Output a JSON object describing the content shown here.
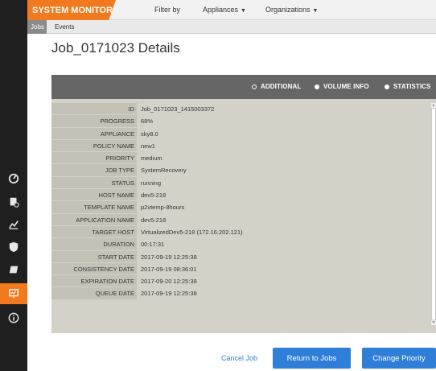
{
  "app": {
    "brand": "SYSTEM MONITOR",
    "colors": {
      "accent": "#f07a1d",
      "primary_button": "#2f7fd8",
      "rail": "#1f1f1f"
    }
  },
  "topbar": {
    "filter_label": "Filter by",
    "appliances_label": "Appliances",
    "organizations_label": "Organizations"
  },
  "subnav": {
    "tabs": [
      {
        "label": "Jobs",
        "active": true
      },
      {
        "label": "Events",
        "active": false
      }
    ]
  },
  "sidebar": {
    "icons": [
      "dashboard-icon",
      "storage-icon",
      "chart-icon",
      "shield-icon",
      "drive-icon",
      "monitor-icon",
      "info-icon"
    ],
    "active": "monitor-icon"
  },
  "page": {
    "title": "Job_0171023 Details"
  },
  "panel": {
    "tabs": [
      {
        "label": "ADDITIONAL",
        "selected": true
      },
      {
        "label": "VOLUME INFO",
        "selected": false
      },
      {
        "label": "STATISTICS",
        "selected": false
      }
    ],
    "rows": [
      {
        "label": "ID",
        "value": "Job_0171023_1415003372"
      },
      {
        "label": "PROGRESS",
        "value": "68%"
      },
      {
        "label": "APPLIANCE",
        "value": "sky8.0"
      },
      {
        "label": "POLICY NAME",
        "value": "new1"
      },
      {
        "label": "PRIORITY",
        "value": "medium"
      },
      {
        "label": "JOB TYPE",
        "value": "SystemRecovery"
      },
      {
        "label": "STATUS",
        "value": "running"
      },
      {
        "label": "HOST NAME",
        "value": "dev5-218"
      },
      {
        "label": "TEMPLATE NAME",
        "value": "p2vtemp-8hours"
      },
      {
        "label": "APPLICATION NAME",
        "value": "dev5-218"
      },
      {
        "label": "TARGET HOST",
        "value": "VirtualizedDev5-218 (172.16.202.121)"
      },
      {
        "label": "DURATION",
        "value": "00:17:31"
      },
      {
        "label": "START DATE",
        "value": "2017-09-19 12:25:38"
      },
      {
        "label": "CONSISTENCY DATE",
        "value": "2017-09-19 08:36:01"
      },
      {
        "label": "EXPIRATION DATE",
        "value": "2017-09-20 12:25:38"
      },
      {
        "label": "QUEUE DATE",
        "value": "2017-09-19 12:25:38"
      }
    ]
  },
  "actions": {
    "cancel_label": "Cancel Job",
    "return_label": "Return to Jobs",
    "priority_label": "Change Priority"
  }
}
